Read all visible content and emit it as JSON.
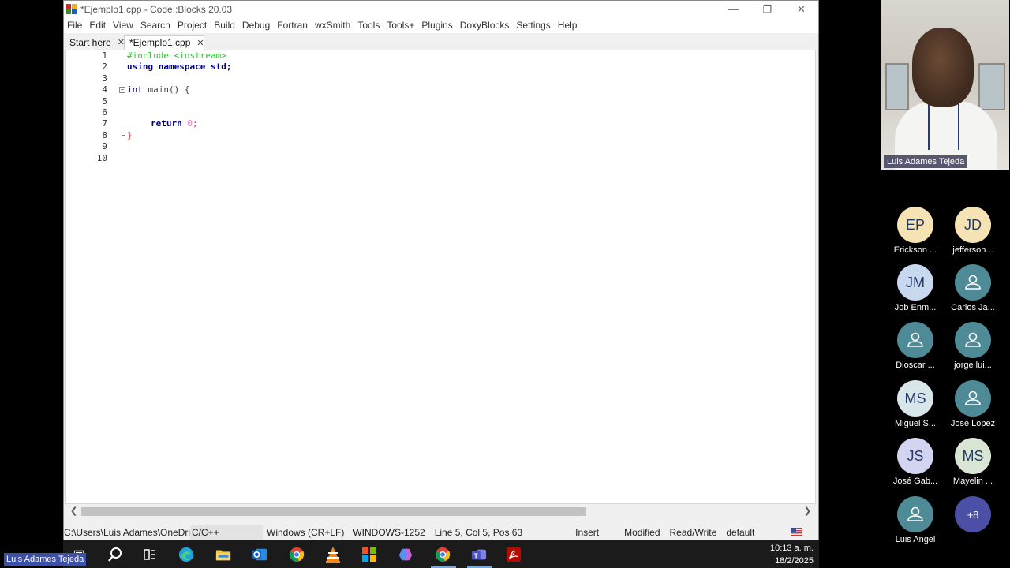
{
  "window": {
    "title": "*Ejemplo1.cpp - Code::Blocks 20.03",
    "controls": [
      "minimize",
      "restore",
      "close"
    ]
  },
  "menu": [
    "File",
    "Edit",
    "View",
    "Search",
    "Project",
    "Build",
    "Debug",
    "Fortran",
    "wxSmith",
    "Tools",
    "Tools+",
    "Plugins",
    "DoxyBlocks",
    "Settings",
    "Help"
  ],
  "tabs": [
    {
      "label": "Start here",
      "active": false
    },
    {
      "label": "*Ejemplo1.cpp",
      "active": true
    }
  ],
  "editor": {
    "line_numbers": [
      "1",
      "2",
      "3",
      "4",
      "5",
      "6",
      "7",
      "8",
      "9",
      "10"
    ],
    "code": {
      "l1": "#include <iostream>",
      "l2_kw": "using namespace",
      "l2_rest": " std;",
      "l4_kw": "int",
      "l4_rest": " main() {",
      "l7_kw": "return",
      "l7_num": "0",
      "l7_semi": ";",
      "l8": "}"
    }
  },
  "status": {
    "path": "C:\\Users\\Luis Adames\\OneDri...",
    "language": "C/C++",
    "line_endings": "Windows (CR+LF)",
    "encoding": "WINDOWS-1252",
    "position": "Line 5, Col 5, Pos 63",
    "mode": "Insert",
    "modified": "Modified",
    "access": "Read/Write",
    "profile": "default"
  },
  "taskbar": {
    "time": "10:13 a. m.",
    "date": "18/2/2025",
    "icons": [
      "windows-start-icon",
      "search-icon",
      "task-view-icon",
      "edge-icon",
      "file-explorer-icon",
      "outlook-icon",
      "chrome-icon",
      "vlc-icon",
      "office-icon",
      "copilot-icon",
      "chrome-icon-2",
      "teams-icon",
      "acrobat-icon"
    ]
  },
  "presenter_tag": "Luis Adames Tejeda",
  "meeting": {
    "speaker": "Luis Adames Tejeda",
    "participants": [
      {
        "initials": "EP",
        "name": "Erickson ...",
        "color": "#f6e3b4"
      },
      {
        "initials": "JD",
        "name": "jefferson...",
        "color": "#f6e3b4"
      },
      {
        "initials": "JM",
        "name": "Job Enm...",
        "color": "#c7d8ef"
      },
      {
        "initials": "",
        "name": "Carlos Ja...",
        "color": "#4e8b96"
      },
      {
        "initials": "",
        "name": "Dioscar ...",
        "color": "#4e8b96"
      },
      {
        "initials": "",
        "name": "jorge lui...",
        "color": "#4e8b96"
      },
      {
        "initials": "MS",
        "name": "Miguel S...",
        "color": "#d8e6ea"
      },
      {
        "initials": "",
        "name": "Jose Lopez",
        "color": "#4e8b96"
      },
      {
        "initials": "JS",
        "name": "José Gab...",
        "color": "#d3d4f0"
      },
      {
        "initials": "MS",
        "name": "Mayelin ...",
        "color": "#d9e6d5"
      },
      {
        "initials": "",
        "name": "Luis Angel",
        "color": "#4e8b96"
      }
    ],
    "more_count": "+8"
  }
}
